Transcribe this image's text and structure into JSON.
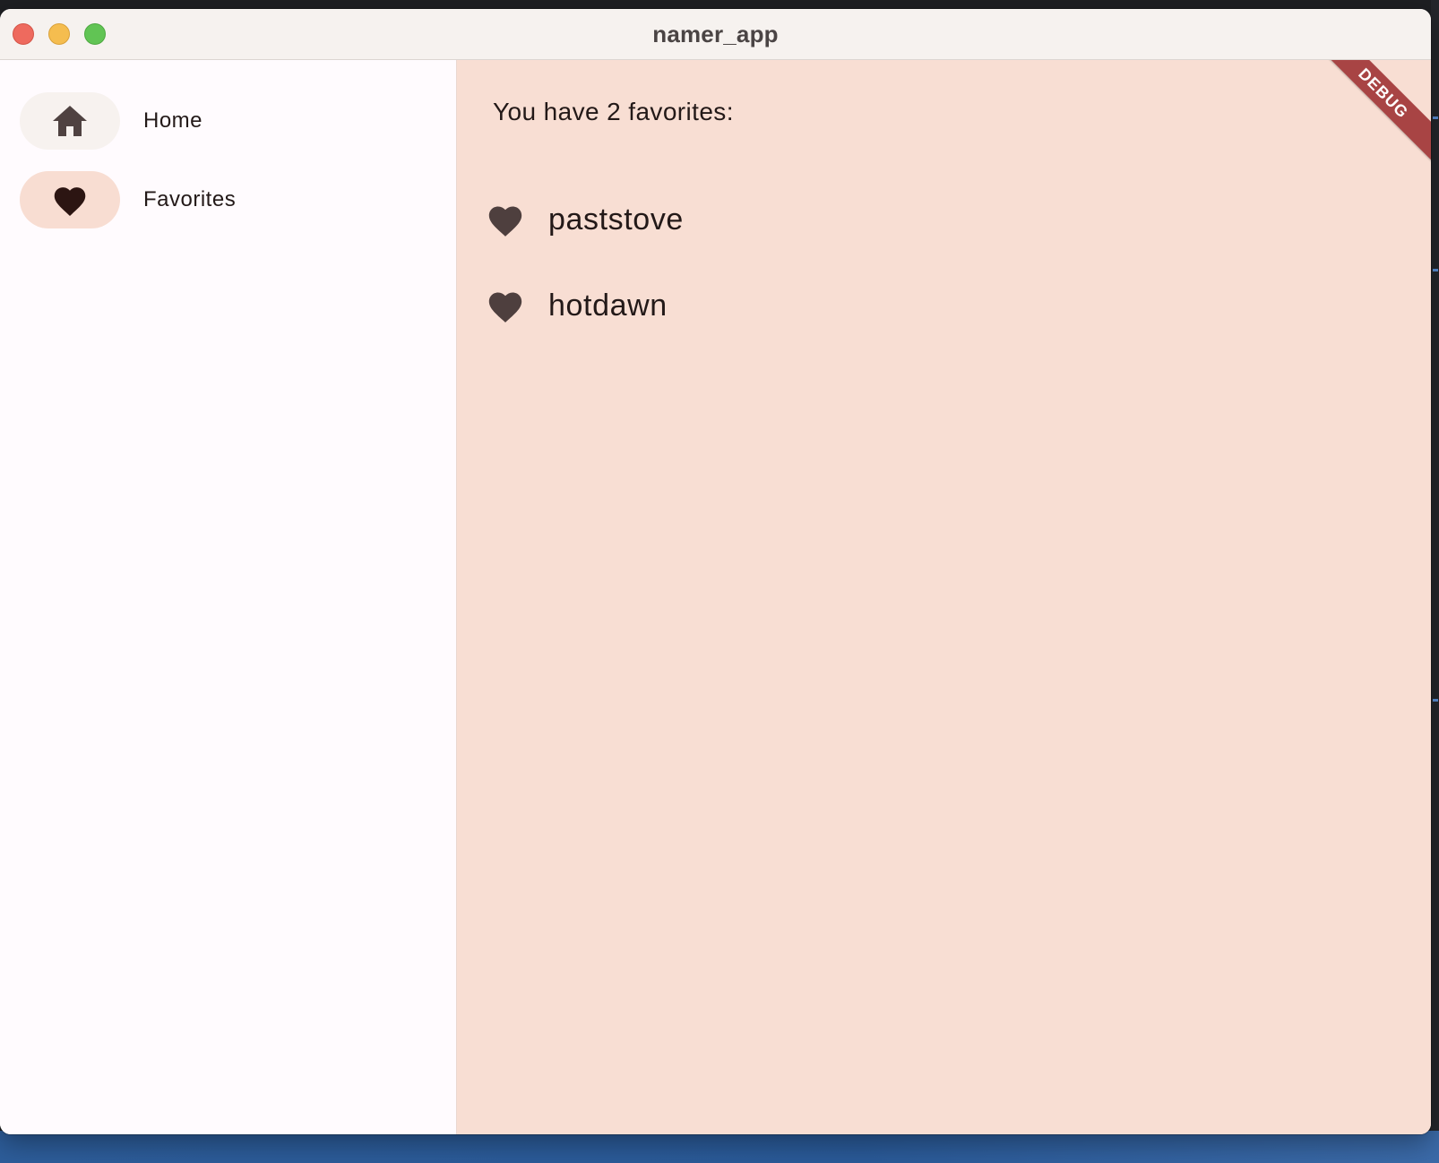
{
  "window": {
    "title": "namer_app"
  },
  "sidebar": {
    "items": [
      {
        "label": "Home",
        "icon": "home-icon",
        "selected": false
      },
      {
        "label": "Favorites",
        "icon": "heart-icon",
        "selected": true
      }
    ]
  },
  "main": {
    "count_text": "You have 2 favorites:",
    "favorites": [
      {
        "name": "paststove",
        "icon": "heart-icon"
      },
      {
        "name": "hotdawn",
        "icon": "heart-icon"
      }
    ]
  },
  "debug_banner": "DEBUG",
  "colors": {
    "content_background": "#f8ded3",
    "sidebar_background": "#fffbfe",
    "selected_pill": "#f8ddd2",
    "debug_banner": "#a84444"
  }
}
